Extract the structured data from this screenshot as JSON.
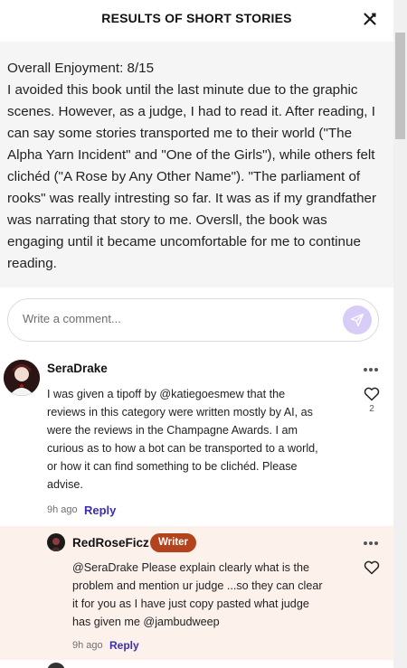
{
  "header": {
    "title": "RESULTS OF SHORT STORIES",
    "close_icon": "close-icon"
  },
  "review": {
    "lines": [
      "Overall Enjoyment: 8/15",
      "I avoided this book until the last minute due to the graphic",
      "scenes. However, as a judge, I had to read it. After reading, I",
      "can say some stories transported me to their world (\"The",
      "Alpha Yarn Incident\" and \"One of the Girls\"), while others felt",
      "clichéd (\"A Rose by Any Other Name\"). \"The parliament of",
      "rooks\" was really intresting so far. It was as if my grandfather",
      "was narrating that story to me. Oversll, the book was",
      "engaging until it became uncomfortable for me to continue",
      "reading."
    ]
  },
  "comment_input": {
    "placeholder": "Write a comment...",
    "send_icon": "send-icon"
  },
  "comments": [
    {
      "username": "SeraDrake",
      "lines": [
        "I was given a tipoff by @katiegoesmew that the",
        "reviews in this category were written mostly by AI, as",
        "were the reviews in the Champagne Awards. I am",
        "curious as to how a bot can be transported to a world,",
        "or how it can find something to be clichéd. Please",
        "advise."
      ],
      "time": "9h ago",
      "reply_label": "Reply",
      "likes": "2"
    }
  ],
  "reply": {
    "username": "RedRoseFicz",
    "badge": "Writer",
    "lines": [
      "@SeraDrake Please explain clearly what is the",
      "problem and mention ur judge ...so they can clear",
      "it for you as I have just copy pasted what judge",
      "has given me @jambudweep"
    ],
    "time": "9h ago",
    "reply_label": "Reply"
  },
  "colors": {
    "accent": "#3a2fb0",
    "badge": "#b3431d",
    "send_button": "#d7cdf7",
    "reply_background": "#fdf1ec",
    "review_background": "#f5f5f5"
  }
}
